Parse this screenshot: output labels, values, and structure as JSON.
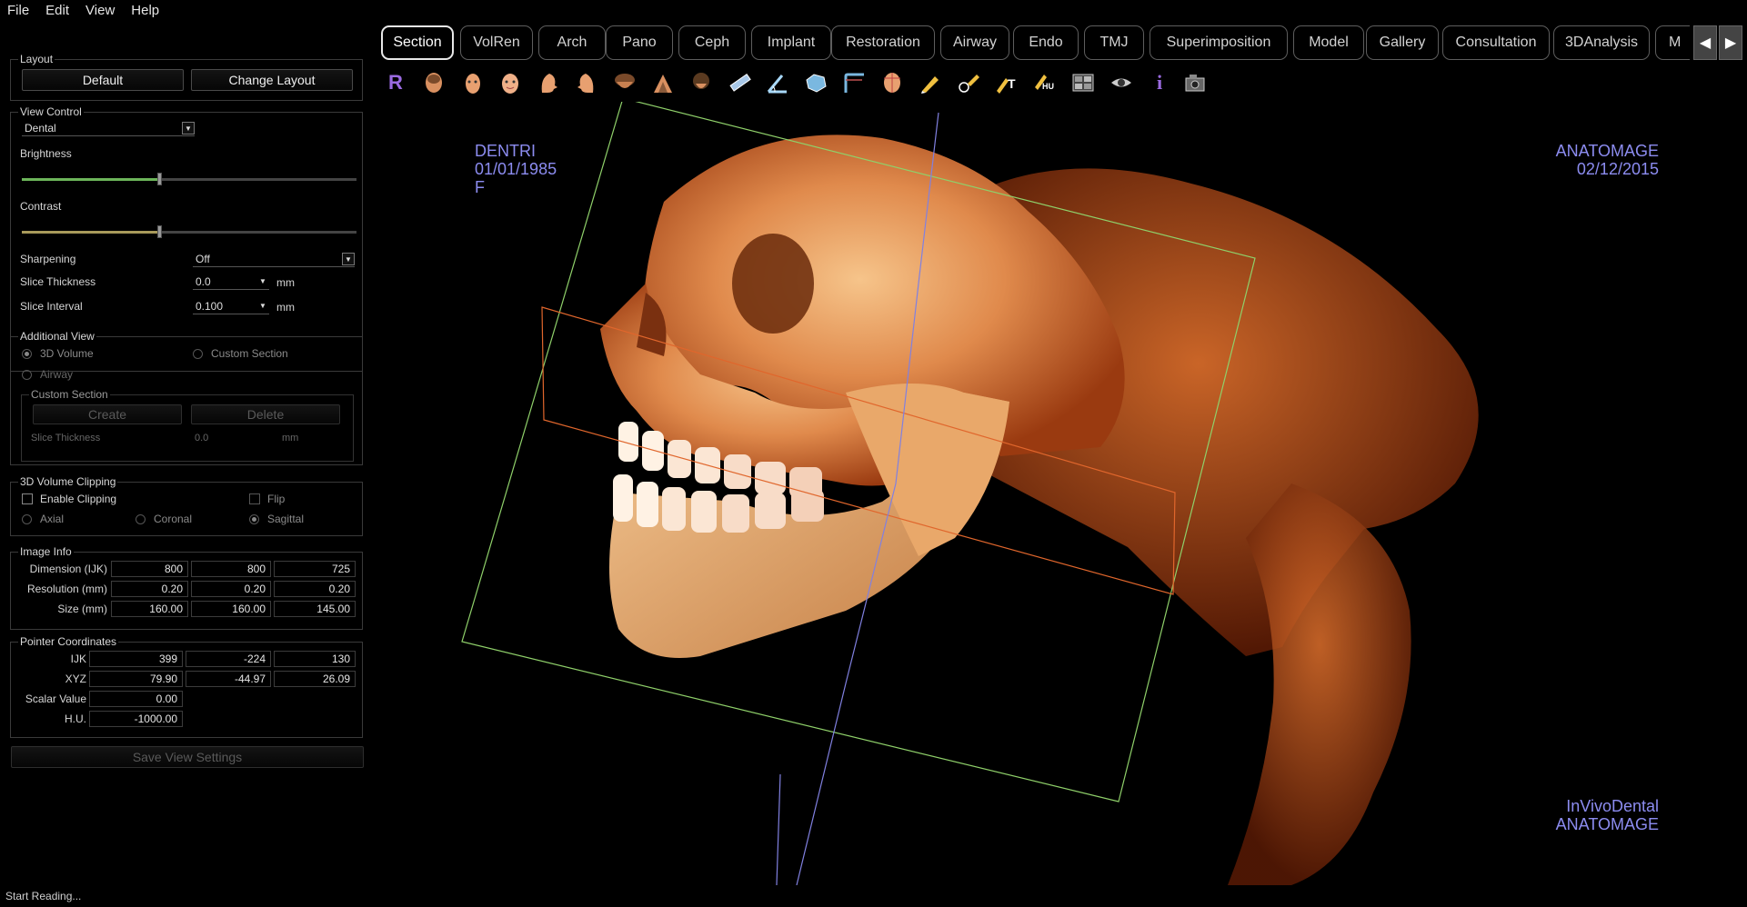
{
  "menubar": {
    "items": [
      "File",
      "Edit",
      "View",
      "Help"
    ]
  },
  "layout_group": {
    "title": "Layout",
    "default_label": "Default",
    "change_label": "Change Layout"
  },
  "view_control": {
    "title": "View Control",
    "mode": "Dental",
    "brightness_label": "Brightness",
    "brightness_level": 0.41,
    "contrast_label": "Contrast",
    "contrast_level": 0.41,
    "sharpening_label": "Sharpening",
    "sharpening_value": "Off",
    "slice_thickness_label": "Slice Thickness",
    "slice_thickness_value": "0.0",
    "slice_interval_label": "Slice Interval",
    "slice_interval_value": "0.100",
    "unit": "mm"
  },
  "additional_view": {
    "title": "Additional View",
    "volume_label": "3D Volume",
    "custom_label": "Custom Section",
    "airway_label": "Airway",
    "custom_section_title": "Custom Section",
    "create_label": "Create",
    "delete_label": "Delete",
    "slice_thickness_label": "Slice Thickness",
    "slice_thickness_value": "0.0",
    "unit": "mm"
  },
  "clipping": {
    "title": "3D Volume Clipping",
    "enable_label": "Enable Clipping",
    "flip_label": "Flip",
    "axial_label": "Axial",
    "coronal_label": "Coronal",
    "sagittal_label": "Sagittal"
  },
  "image_info": {
    "title": "Image Info",
    "rows": [
      {
        "label": "Dimension (IJK)",
        "values": [
          "800",
          "800",
          "725"
        ]
      },
      {
        "label": "Resolution (mm)",
        "values": [
          "0.20",
          "0.20",
          "0.20"
        ]
      },
      {
        "label": "Size (mm)",
        "values": [
          "160.00",
          "160.00",
          "145.00"
        ]
      }
    ]
  },
  "pointer": {
    "title": "Pointer Coordinates",
    "ijk_label": "IJK",
    "ijk": [
      "399",
      "-224",
      "130"
    ],
    "xyz_label": "XYZ",
    "xyz": [
      "79.90",
      "-44.97",
      "26.09"
    ],
    "scalar_label": "Scalar Value",
    "scalar": "0.00",
    "hu_label": "H.U.",
    "hu": "-1000.00"
  },
  "save_view_label": "Save View Settings",
  "tabs": [
    "Section",
    "VolRen",
    "Arch",
    "Pano",
    "Ceph",
    "Implant",
    "Restoration",
    "Airway",
    "Endo",
    "TMJ",
    "Superimposition",
    "Model",
    "Gallery",
    "Consultation",
    "3DAnalysis",
    "M"
  ],
  "active_tab": "Section",
  "nav": {
    "prev": "◀",
    "next": "▶"
  },
  "toolbar_icons": [
    "reset-icon",
    "face-front-icon",
    "face-left-icon",
    "face-right-icon",
    "face-top-icon",
    "face-bottom-icon",
    "skull-left-icon",
    "skull-right-icon",
    "skull-top-icon",
    "ruler-icon",
    "angle-icon",
    "area-icon",
    "curve-icon",
    "face-measure-icon",
    "pencil-icon",
    "pencil-circle-icon",
    "text-icon",
    "hu-icon",
    "layout-icon",
    "eye-icon",
    "info-icon",
    "camera-icon"
  ],
  "toolbar_reset": "R",
  "toolbar_info": "i",
  "toolbar_text": "T",
  "toolbar_hu": "HU",
  "overlay": {
    "patient_name": "DENTRI",
    "patient_dob": "01/01/1985",
    "patient_sex": "F",
    "clinic_name": "ANATOMAGE",
    "scan_date": "02/12/2015",
    "product_line1": "InVivoDental",
    "product_line2": "ANATOMAGE"
  },
  "colors": {
    "accent_green": "#6cb55a",
    "overlay_text": "#8c8cf0",
    "bone": "#e0824a",
    "plane_green": "#8fd06a",
    "plane_orange": "#e0662c",
    "plane_blue": "#8080e0"
  },
  "status_text": "Start Reading..."
}
